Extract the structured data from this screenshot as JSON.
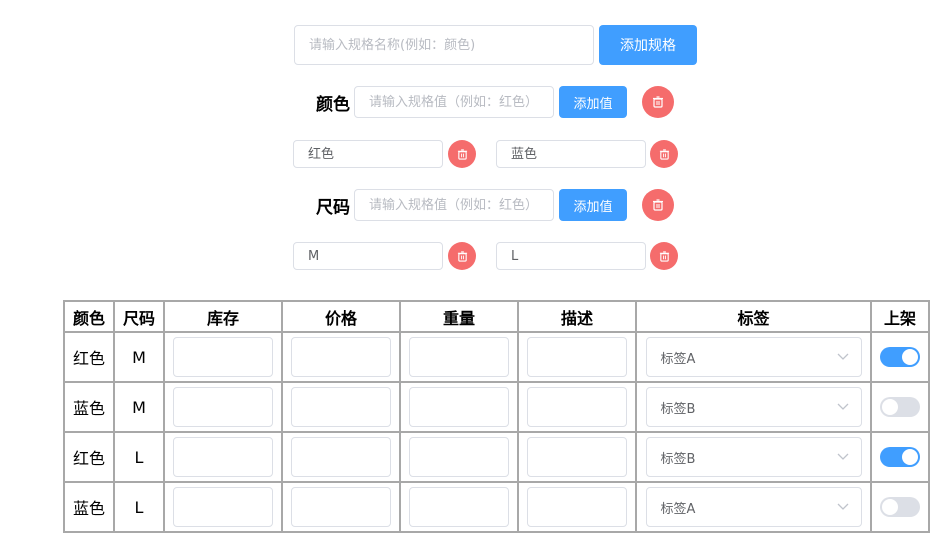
{
  "spec_form": {
    "name_placeholder": "请输入规格名称(例如：颜色)",
    "add_spec_label": "添加规格"
  },
  "specs": [
    {
      "name": "颜色",
      "value_placeholder": "请输入规格值（例如：红色）",
      "add_value_label": "添加值",
      "values": [
        "红色",
        "蓝色"
      ]
    },
    {
      "name": "尺码",
      "value_placeholder": "请输入规格值（例如：红色）",
      "add_value_label": "添加值",
      "values": [
        "M",
        "L"
      ]
    }
  ],
  "table": {
    "headers": [
      "颜色",
      "尺码",
      "库存",
      "价格",
      "重量",
      "描述",
      "标签",
      "上架"
    ],
    "rows": [
      {
        "color": "红色",
        "size": "M",
        "tag": "标签A",
        "on_shelf": true
      },
      {
        "color": "蓝色",
        "size": "M",
        "tag": "标签B",
        "on_shelf": false
      },
      {
        "color": "红色",
        "size": "L",
        "tag": "标签B",
        "on_shelf": true
      },
      {
        "color": "蓝色",
        "size": "L",
        "tag": "标签A",
        "on_shelf": false
      }
    ]
  },
  "colors": {
    "primary": "#409eff",
    "danger": "#f56c6c",
    "switch_off": "#dcdfe6"
  },
  "icons": {
    "delete": "trash-icon",
    "dropdown": "chevron-down-icon"
  }
}
